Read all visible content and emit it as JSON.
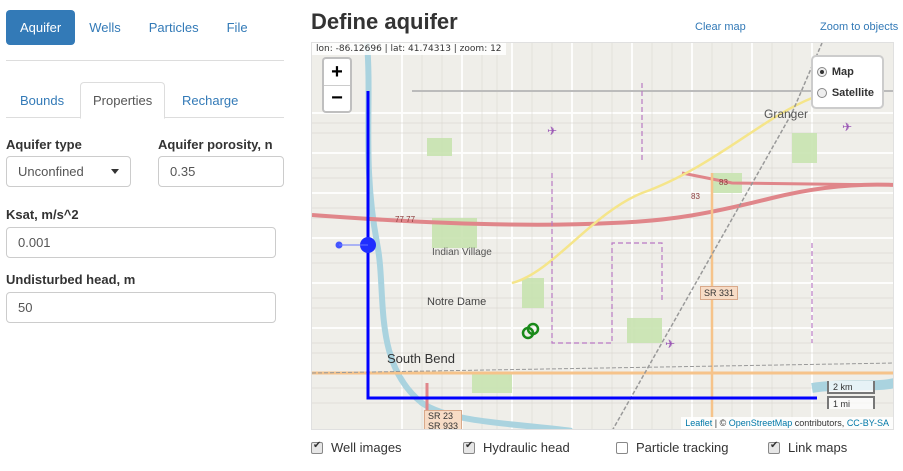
{
  "nav": {
    "tabs": [
      "Aquifer",
      "Wells",
      "Particles",
      "File"
    ]
  },
  "subtabs": [
    "Bounds",
    "Properties",
    "Recharge"
  ],
  "form": {
    "aquifer_type_label": "Aquifer type",
    "aquifer_type_value": "Unconfined",
    "porosity_label": "Aquifer porosity, n",
    "porosity_value": "0.35",
    "ksat_label": "Ksat, m/s^2",
    "ksat_value": "0.001",
    "head_label": "Undisturbed head, m",
    "head_value": "50"
  },
  "header": {
    "title": "Define aquifer",
    "clear_map": "Clear map",
    "zoom_objects": "Zoom to objects"
  },
  "map": {
    "coords": "lon: -86.12696 | lat: 41.74313 | zoom: 12",
    "zoom_in": "+",
    "zoom_out": "−",
    "layers": [
      "Map",
      "Satellite"
    ],
    "selected_layer": "Map",
    "scale_km": "2 km",
    "scale_mi": "1 mi",
    "attribution_leaflet": "Leaflet",
    "attribution_sep": " | © ",
    "attribution_osm": "OpenStreetMap",
    "attribution_contrib": " contributors, ",
    "attribution_license": "CC-BY-SA",
    "labels": {
      "granger": "Granger",
      "indian_village": "Indian Village",
      "notre_dame": "Notre Dame",
      "south_bend": "South Bend",
      "sr331": "SR 331",
      "sr23": "SR 23",
      "sr933": "SR 933",
      "i83a": "83",
      "i83b": "83",
      "i77": "77 77"
    },
    "colors": {
      "boundary": "#0000ff",
      "well": "#1a8a1a",
      "road": "#e0868a",
      "water": "#aad3df",
      "park": "#c8e3b0"
    }
  },
  "options": [
    {
      "label": "Well images",
      "checked": true
    },
    {
      "label": "Hydraulic head",
      "checked": true
    },
    {
      "label": "Particle tracking",
      "checked": false
    },
    {
      "label": "Link maps",
      "checked": true
    }
  ]
}
